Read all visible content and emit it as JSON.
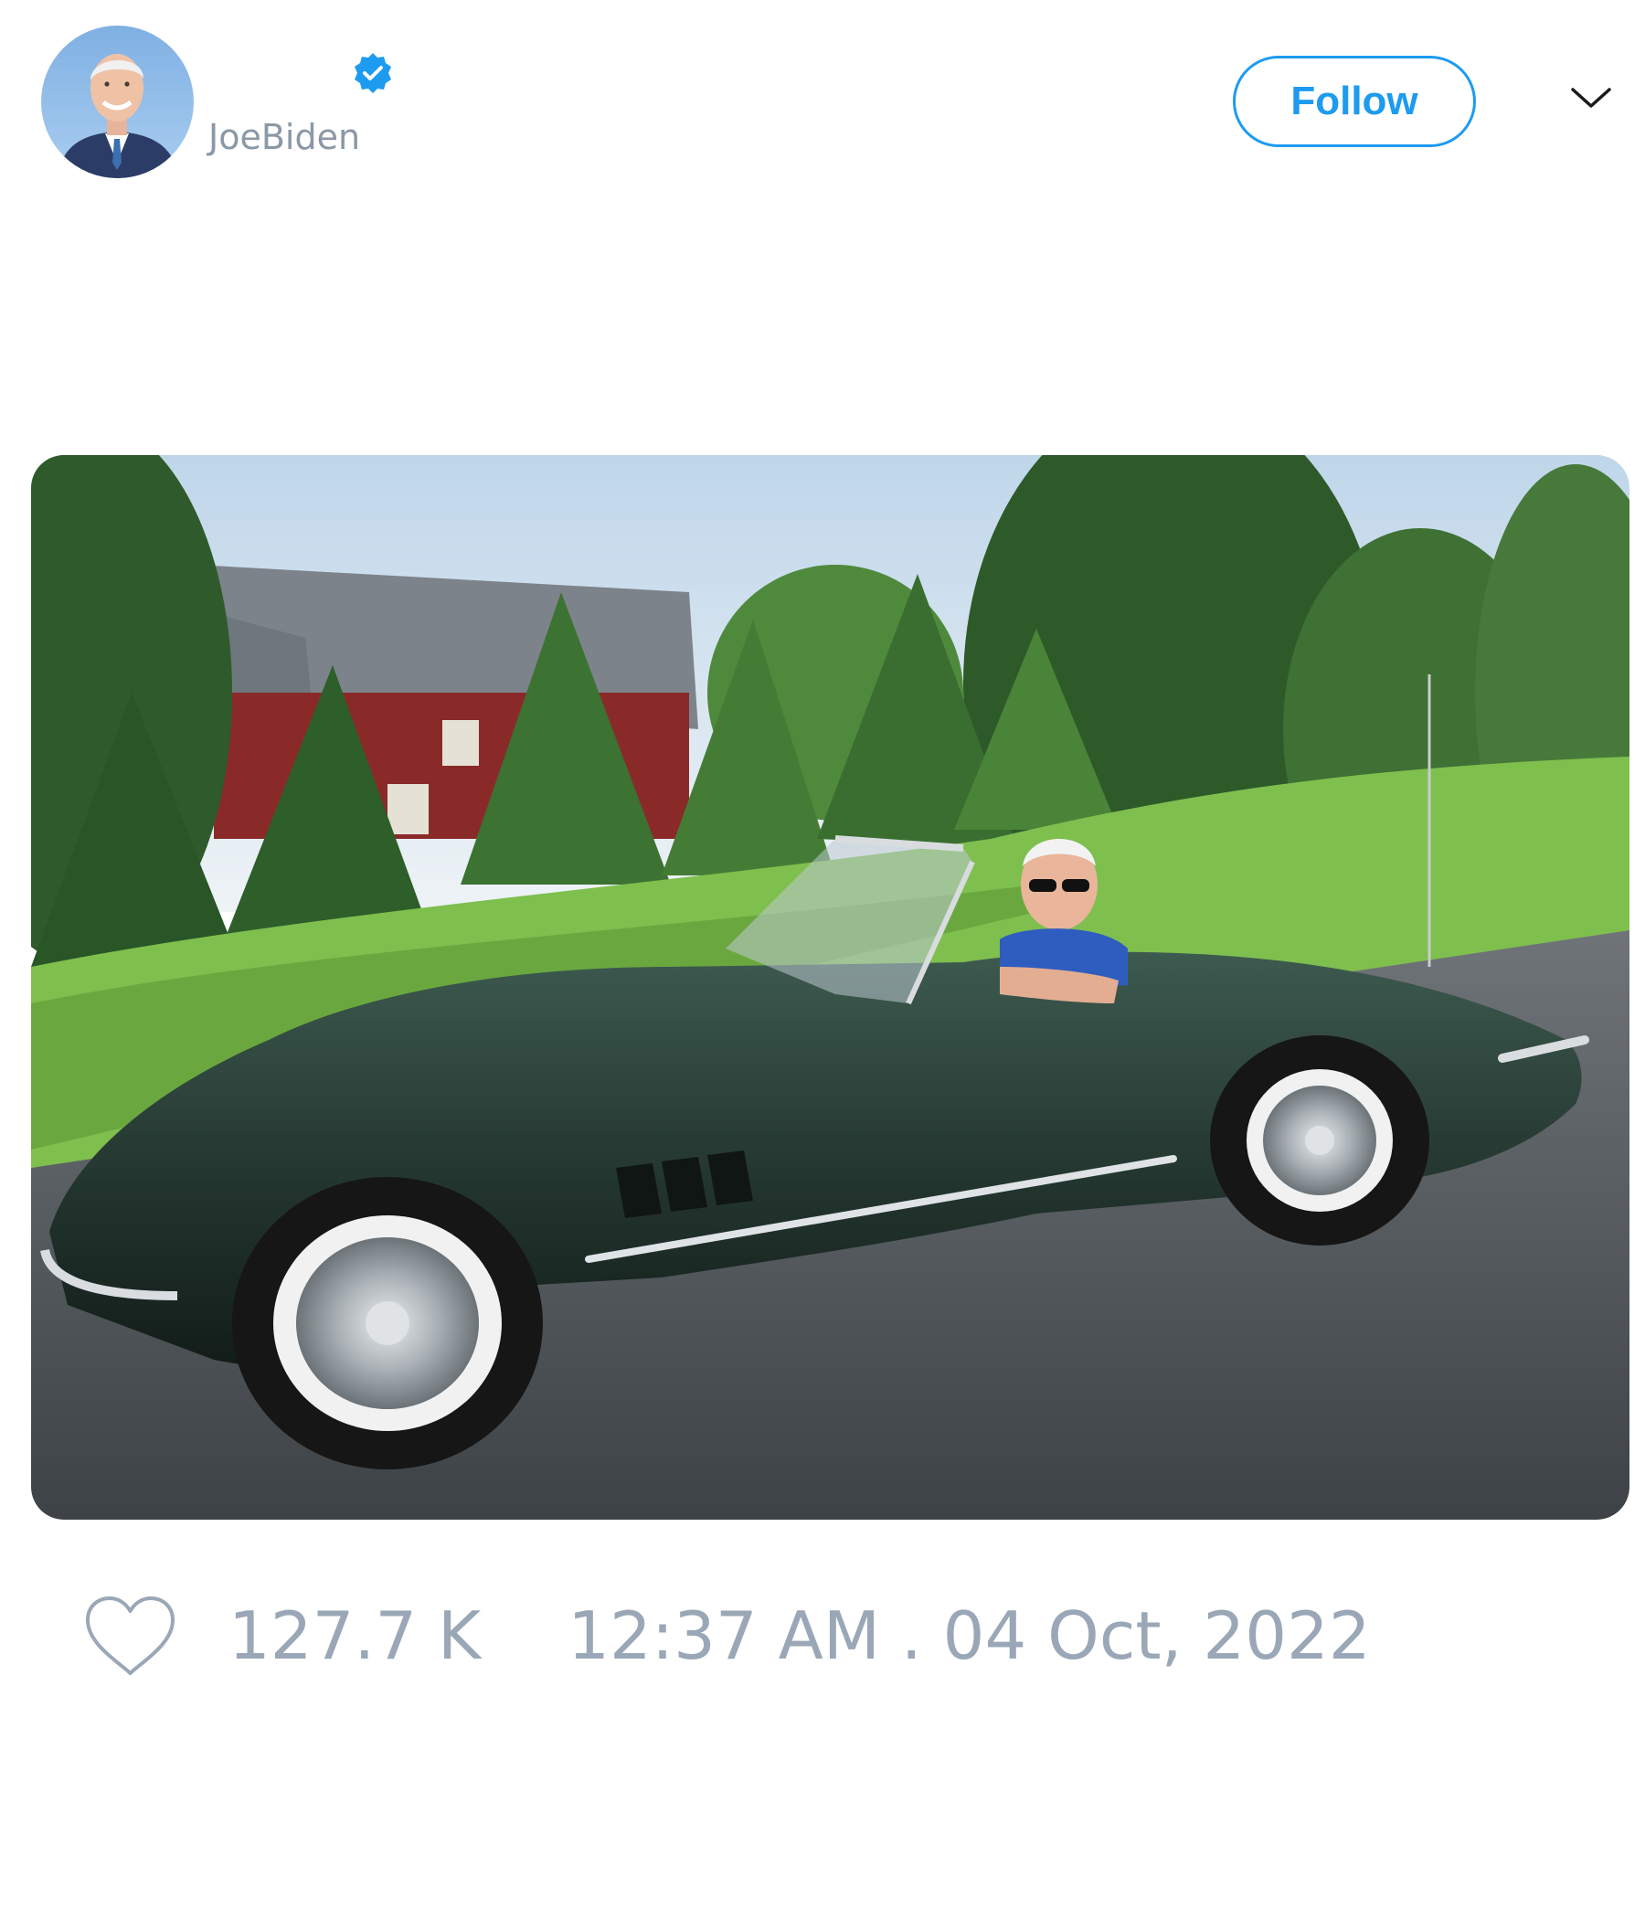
{
  "tweet": {
    "author": {
      "display_name": "",
      "handle": "JoeBiden",
      "verified": true,
      "avatar_icon": "profile-photo"
    },
    "follow_label": "Follow",
    "menu_icon": "chevron-down-icon",
    "media": {
      "icon": "photo-car-convertible"
    },
    "likes_icon": "heart-outline-icon",
    "likes_count": "127.7 K",
    "timestamp": "12:37 AM . 04 Oct, 2022"
  },
  "colors": {
    "accent": "#1d9bf0",
    "muted_text": "#9aa7b6",
    "handle_text": "#8b98a5"
  }
}
